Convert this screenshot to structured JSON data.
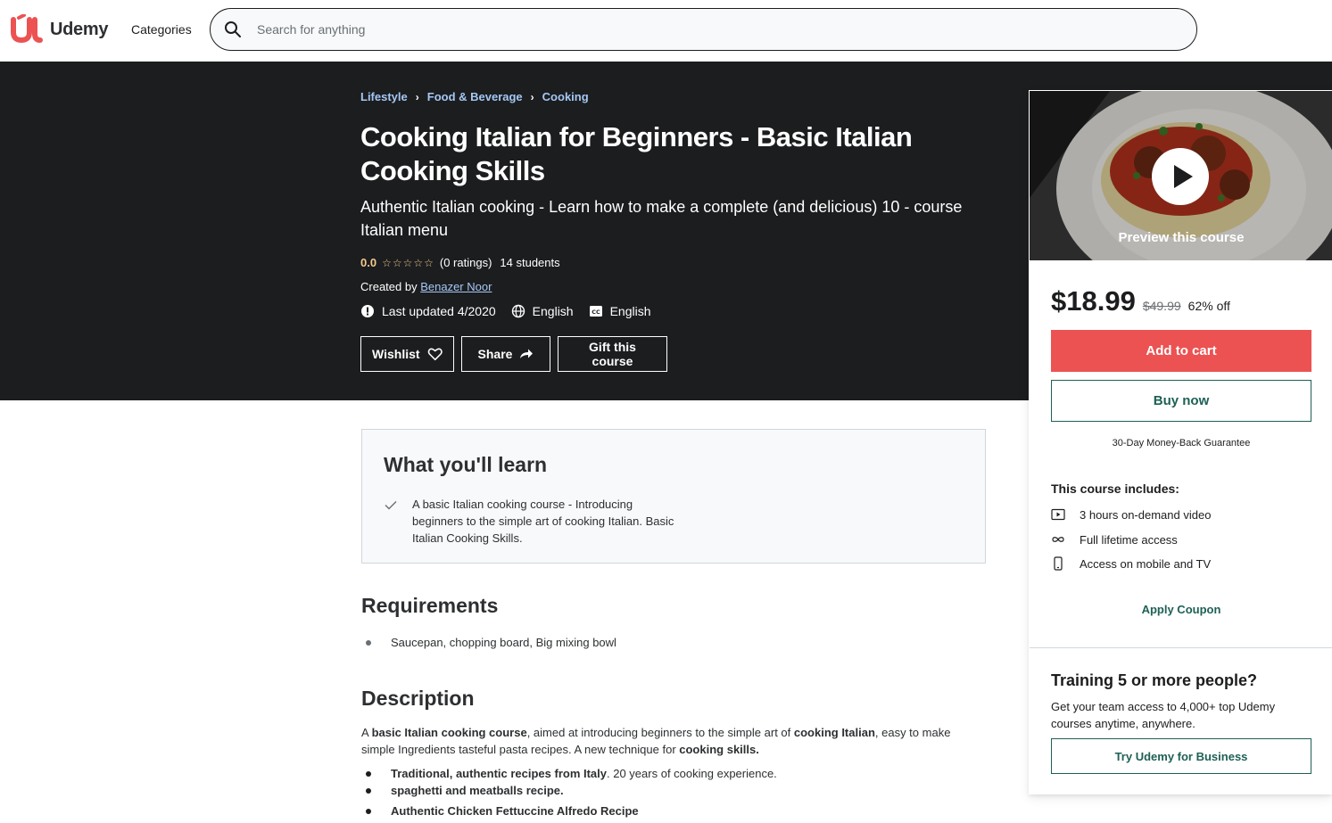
{
  "header": {
    "logo_text": "Udemy",
    "categories_label": "Categories",
    "search_placeholder": "Search for anything",
    "brand_color": "#a435f0",
    "logo_color": "#ec5252"
  },
  "hero": {
    "breadcrumb": [
      "Lifestyle",
      "Food & Beverage",
      "Cooking"
    ],
    "title": "Cooking Italian for Beginners - Basic Italian Cooking Skills",
    "subtitle": "Authentic Italian cooking - Learn how to make a complete (and delicious) 10 - course Italian menu",
    "rating": "0.0",
    "stars": "☆☆☆☆☆",
    "ratings_count": "(0 ratings)",
    "students": "14 students",
    "created_by_label": "Created by",
    "instructor": "Benazer Noor",
    "last_updated": "Last updated 4/2020",
    "language": "English",
    "captions": "English",
    "wishlist_label": "Wishlist",
    "share_label": "Share",
    "gift_label": "Gift this course"
  },
  "learn": {
    "title": "What you'll learn",
    "items": [
      "A basic Italian cooking course - Introducing beginners to the simple art of cooking Italian. Basic Italian Cooking Skills."
    ]
  },
  "requirements": {
    "title": "Requirements",
    "items": [
      "Saucepan, chopping board, Big mixing bowl"
    ]
  },
  "description": {
    "title": "Description",
    "p_a": "A ",
    "p_b": "basic Italian cooking course",
    "p_c": ", aimed at introducing beginners to the simple art of ",
    "p_d": "cooking Italian",
    "p_e": ", easy to make simple Ingredients tasteful pasta recipes. A new technique for ",
    "p_f": "cooking skills.",
    "li1_bold": "Traditional, authentic recipes from Italy",
    "li1_rest": ".  20 years of cooking experience.",
    "li2": "spaghetti and meatballs recipe.",
    "li3": "Authentic Chicken Fettuccine Alfredo Recipe"
  },
  "sidebar": {
    "preview_label": "Preview this course",
    "price": "$18.99",
    "original_price": "$49.99",
    "discount": "62% off",
    "add_to_cart": "Add to cart",
    "buy_now": "Buy now",
    "guarantee": "30-Day Money-Back Guarantee",
    "includes_title": "This course includes:",
    "includes": [
      {
        "icon": "video-icon",
        "label": "3 hours on-demand video"
      },
      {
        "icon": "infinity-icon",
        "label": "Full lifetime access"
      },
      {
        "icon": "mobile-icon",
        "label": "Access on mobile and TV"
      }
    ],
    "apply_coupon": "Apply Coupon",
    "business_title": "Training 5 or more people?",
    "business_text": "Get your team access to 4,000+ top Udemy courses anytime, anywhere.",
    "business_button": "Try Udemy for Business",
    "cart_color": "#ec5252",
    "accent_color": "#1e6055"
  }
}
